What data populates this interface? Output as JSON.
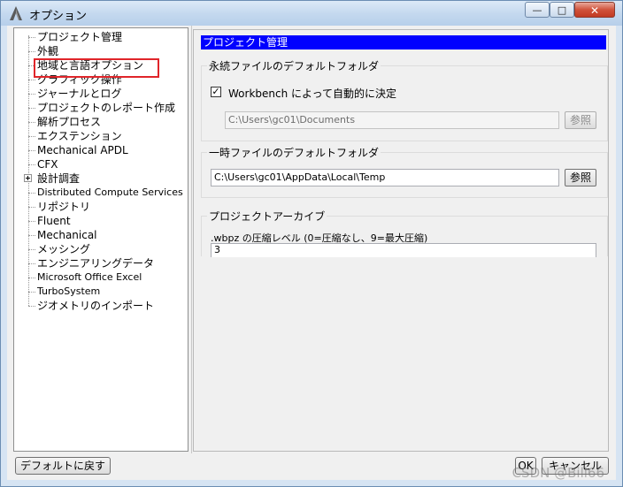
{
  "window": {
    "title": "オプション",
    "controls": {
      "minimize": "—",
      "maximize": "□",
      "close": "✕"
    },
    "icon": "ansys-logo-icon"
  },
  "tree": {
    "items": [
      {
        "label": "プロジェクト管理",
        "expandable": false
      },
      {
        "label": "外観",
        "expandable": false
      },
      {
        "label": "地域と言語オプション",
        "expandable": false
      },
      {
        "label": "グラフィック操作",
        "expandable": false
      },
      {
        "label": "ジャーナルとログ",
        "expandable": false
      },
      {
        "label": "プロジェクトのレポート作成",
        "expandable": false
      },
      {
        "label": "解析プロセス",
        "expandable": false
      },
      {
        "label": "エクステンション",
        "expandable": false
      },
      {
        "label": "Mechanical APDL",
        "expandable": false
      },
      {
        "label": "CFX",
        "expandable": false
      },
      {
        "label": "設計調査",
        "expandable": true
      },
      {
        "label": "Distributed Compute Services",
        "expandable": false
      },
      {
        "label": "リポジトリ",
        "expandable": false
      },
      {
        "label": "Fluent",
        "expandable": false
      },
      {
        "label": "Mechanical",
        "expandable": false
      },
      {
        "label": "メッシング",
        "expandable": false
      },
      {
        "label": "エンジニアリングデータ",
        "expandable": false
      },
      {
        "label": "Microsoft Office Excel",
        "expandable": false
      },
      {
        "label": "TurboSystem",
        "expandable": false
      },
      {
        "label": "ジオメトリのインポート",
        "expandable": false
      }
    ],
    "highlight_color": "#e0252a"
  },
  "panel": {
    "header": "プロジェクト管理",
    "header_color": "#0000ff",
    "persistent": {
      "title": "永続ファイルのデフォルトフォルダ",
      "checkbox_label": "Workbench によって自動的に決定",
      "checkbox_mark": "✓",
      "path": "C:\\Users\\gc01\\Documents",
      "browse_label": "参照"
    },
    "temp": {
      "title": "一時ファイルのデフォルトフォルダ",
      "path": "C:\\Users\\gc01\\AppData\\Local\\Temp",
      "browse_label": "参照"
    },
    "archive": {
      "title": "プロジェクトアーカイブ",
      "compression_label": ".wbpz の圧縮レベル (0=圧縮なし、9=最大圧縮)",
      "compression_value": "3"
    }
  },
  "footer": {
    "defaults_label": "デフォルトに戻す",
    "ok_label": "OK",
    "cancel_label": "キャンセル"
  },
  "watermark": "CSDN @Bill66"
}
